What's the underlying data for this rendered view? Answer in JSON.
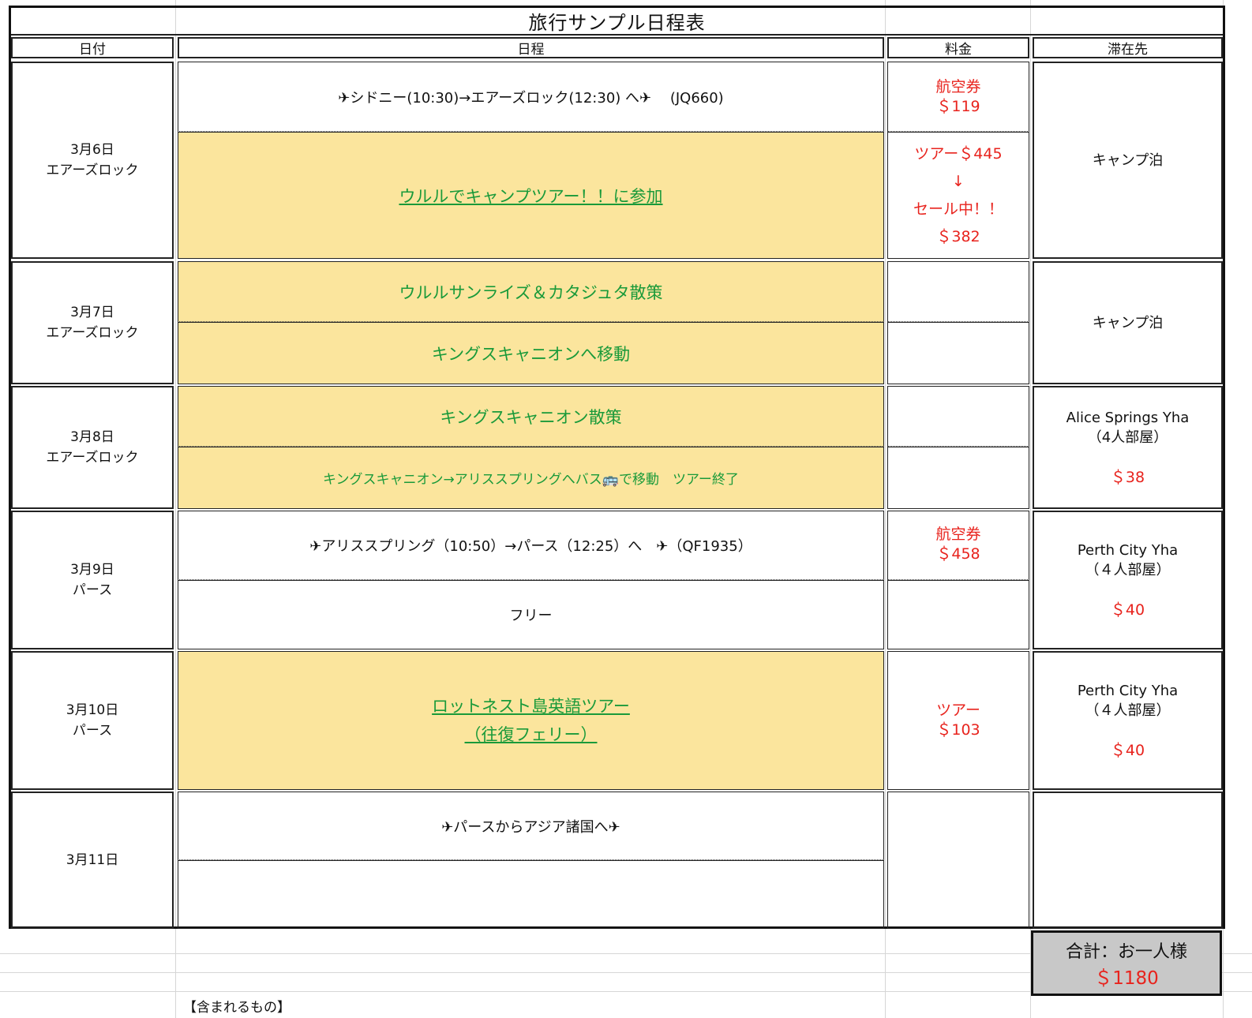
{
  "title": "旅行サンプル日程表",
  "headers": {
    "date": "日付",
    "schedule": "日程",
    "fee": "料金",
    "stay": "滞在先"
  },
  "days": [
    {
      "date": "3月6日",
      "place": "エアーズロック",
      "item1": "✈シドニー(10:30)→エアーズロック(12:30) へ✈　 (JQ660)",
      "item2": "ウルルでキャンプツアー！！に参加",
      "fee1_a": "航空券",
      "fee1_b": "＄119",
      "fee2_a": "ツアー＄445",
      "fee2_b": "↓",
      "fee2_c": "セール中！！",
      "fee2_d": "＄382",
      "stay": "キャンプ泊"
    },
    {
      "date": "3月7日",
      "place": "エアーズロック",
      "item1": "ウルルサンライズ＆カタジュタ散策",
      "item2": "キングスキャニオンへ移動",
      "stay": "キャンプ泊"
    },
    {
      "date": "3月8日",
      "place": "エアーズロック",
      "item1": "キングスキャニオン散策",
      "item2": "キングスキャニオン→アリススプリングへバス🚌で移動　ツアー終了",
      "stay_name": "Alice Springs Yha",
      "stay_room": "（4人部屋）",
      "stay_price": "＄38"
    },
    {
      "date": "3月9日",
      "place": "パース",
      "item1": "✈アリススプリング（10:50）→パース（12:25）へ　✈（QF1935）",
      "item2": "フリー",
      "fee1_a": "航空券",
      "fee1_b": "＄458",
      "stay_name": "Perth City Yha",
      "stay_room": "（４人部屋）",
      "stay_price": "＄40"
    },
    {
      "date": "3月10日",
      "place": "パース",
      "item1": "ロットネスト島英語ツアー",
      "item1b": "（往復フェリー）",
      "fee1_a": "ツアー",
      "fee1_b": "＄103",
      "stay_name": "Perth City Yha",
      "stay_room": "（４人部屋）",
      "stay_price": "＄40"
    },
    {
      "date": "3月11日",
      "place": "",
      "item1": "✈パースからアジア諸国へ✈"
    }
  ],
  "total": {
    "label": "合計：お一人様",
    "amount": "＄1180"
  },
  "note": "【含まれるもの】"
}
